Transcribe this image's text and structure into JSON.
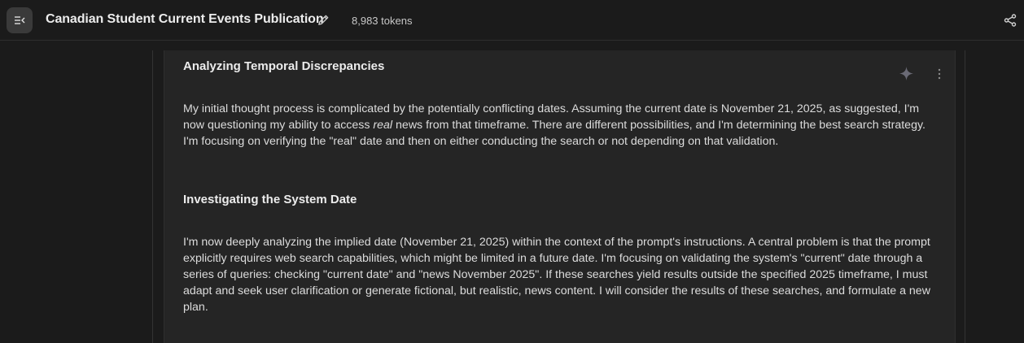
{
  "header": {
    "title": "Canadian Student Current Events Publication",
    "tokens": "8,983 tokens"
  },
  "icons": {
    "menu": "sidebar-toggle-icon",
    "edit": "pencil-icon",
    "share": "share-icon",
    "sparkle": "sparkle-icon",
    "more": "more-vertical-icon"
  },
  "thoughts": {
    "section1": {
      "heading": "Analyzing Temporal Discrepancies",
      "text_before": "My initial thought process is complicated by the potentially conflicting dates. Assuming the current date is November 21, 2025, as suggested, I'm now questioning my ability to access ",
      "text_emphasis": "real",
      "text_after": " news from that timeframe. There are different possibilities, and I'm determining the best search strategy. I'm focusing on verifying the \"real\" date and then on either conducting the search or not depending on that validation."
    },
    "section2": {
      "heading": "Investigating the System Date",
      "text": "I'm now deeply analyzing the implied date (November 21, 2025) within the context of the prompt's instructions. A central problem is that the prompt explicitly requires web search capabilities, which might be limited in a future date. I'm focusing on validating the system's \"current\" date through a series of queries: checking \"current date\" and \"news November 2025\". If these searches yield results outside the specified 2025 timeframe, I must adapt and seek user clarification or generate fictional, but realistic, news content. I will consider the results of these searches, and formulate a new plan."
    }
  },
  "colors": {
    "background": "#1b1b1b",
    "card": "#252525",
    "text": "#dcdcdc"
  }
}
